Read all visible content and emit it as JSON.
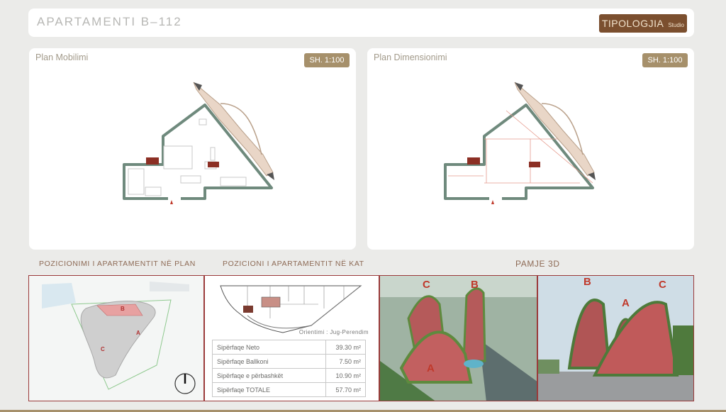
{
  "header": {
    "title": "APARTAMENTI  B–112",
    "type_main": "TIPOLOGJIA",
    "type_sub": "Studio"
  },
  "plans": [
    {
      "title": "Plan Mobilimi",
      "scale": "SH. 1:100"
    },
    {
      "title": "Plan Dimensionimi",
      "scale": "SH. 1:100"
    }
  ],
  "sections": {
    "position_plan": "POZICIONIMI I APARTAMENTIT NË PLAN",
    "position_floor": "POZICIONI I APARTAMENTIT NË KAT",
    "view_3d": "PAMJE 3D"
  },
  "building_labels": {
    "a": "A",
    "b": "B",
    "c": "C"
  },
  "orientation": "Orientimi : Jug-Perendim",
  "areas": [
    {
      "label": "Sipërfaqe Neto",
      "value": "39.30 m²"
    },
    {
      "label": "Sipërfaqe Ballkoni",
      "value": "7.50 m²"
    },
    {
      "label": "Sipërfaqe e përbashkët",
      "value": "10.90 m²"
    },
    {
      "label": "Sipërfaqe TOTALE",
      "value": "57.70 m²"
    }
  ],
  "colors": {
    "accent": "#a6906b",
    "brand_brown": "#7b4f2f",
    "frame_red": "#9b3a3a",
    "wall": "#6f8a7d"
  }
}
